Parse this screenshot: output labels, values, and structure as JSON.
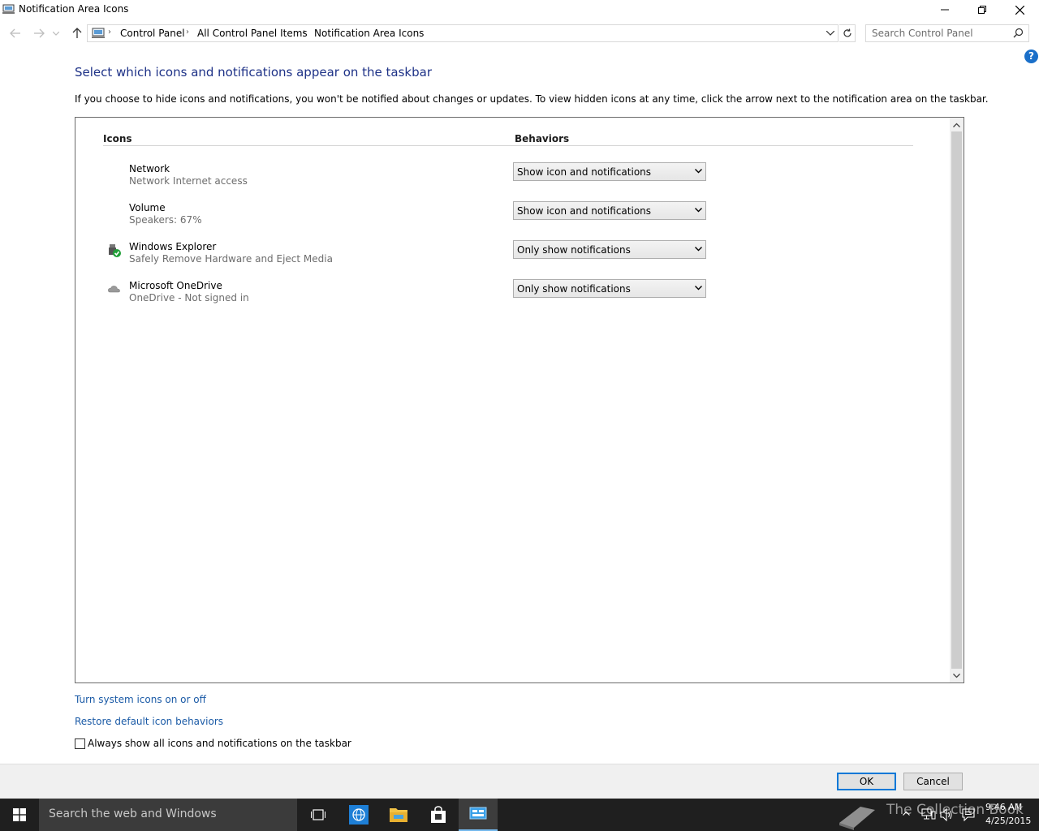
{
  "window": {
    "title": "Notification Area Icons"
  },
  "address": {
    "crumbs": [
      "Control Panel",
      "All Control Panel Items",
      "Notification Area Icons"
    ]
  },
  "search": {
    "placeholder": "Search Control Panel"
  },
  "help": {
    "label": "?"
  },
  "page": {
    "title": "Select which icons and notifications appear on the taskbar",
    "description": "If you choose to hide icons and notifications, you won't be notified about changes or updates. To view hidden icons at any time, click the arrow next to the notification area on the taskbar."
  },
  "table": {
    "col_icons": "Icons",
    "col_behaviors": "Behaviors",
    "rows": [
      {
        "name": "Network",
        "detail": "Network Internet access",
        "behavior": "Show icon and notifications",
        "icon": "network-icon"
      },
      {
        "name": "Volume",
        "detail": "Speakers: 67%",
        "behavior": "Show icon and notifications",
        "icon": "volume-icon"
      },
      {
        "name": "Windows Explorer",
        "detail": "Safely Remove Hardware and Eject Media",
        "behavior": "Only show notifications",
        "icon": "usb-safe-remove-icon"
      },
      {
        "name": "Microsoft OneDrive",
        "detail": "OneDrive - Not signed in",
        "behavior": "Only show notifications",
        "icon": "onedrive-cloud-icon"
      }
    ]
  },
  "links": {
    "system_icons": "Turn system icons on or off",
    "restore": "Restore default icon behaviors"
  },
  "checkbox": {
    "label": "Always show all icons and notifications on the taskbar",
    "checked": false
  },
  "buttons": {
    "ok": "OK",
    "cancel": "Cancel"
  },
  "taskbar": {
    "search_text": "Search the web and Windows",
    "watermark": "The Collection Book",
    "time": "9:46 AM",
    "date": "4/25/2015"
  },
  "colors": {
    "title_blue": "#1e3287",
    "link_blue": "#1a5aa6",
    "accent": "#0078d7",
    "taskbar": "#1f1f1f"
  }
}
